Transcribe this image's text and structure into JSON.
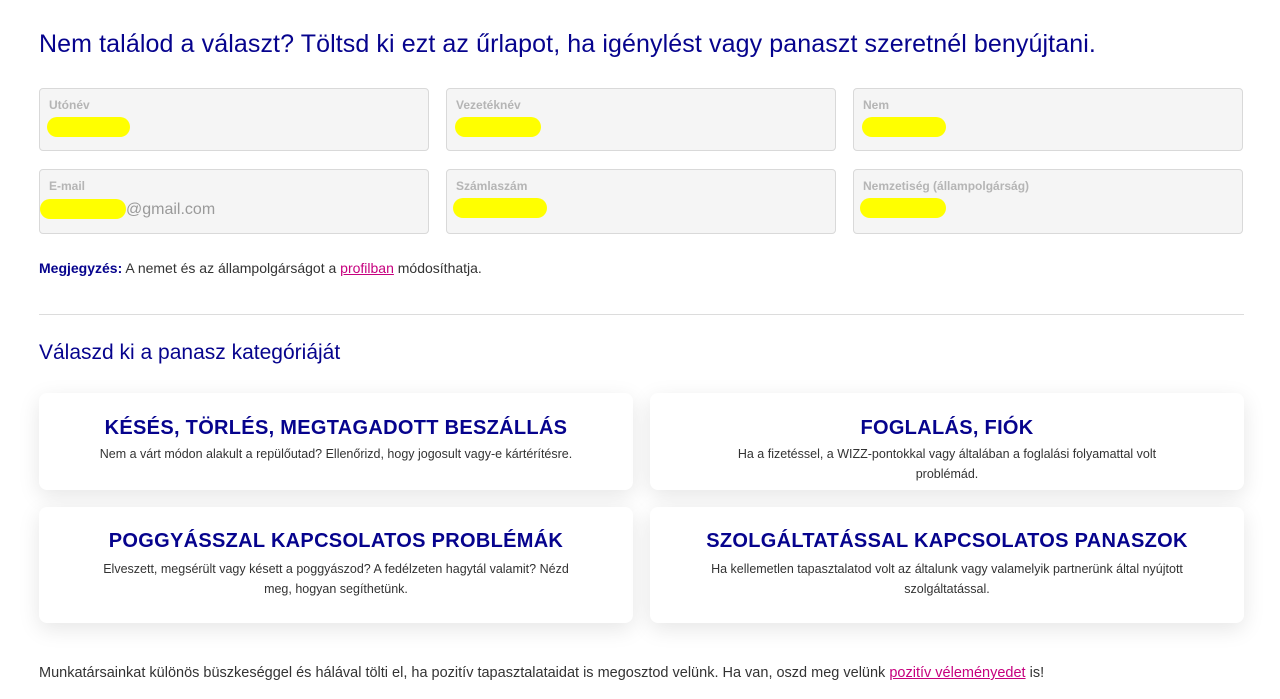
{
  "heading": "Nem találod a választ? Töltsd ki ezt az űrlapot, ha igénylést vagy panaszt szeretnél benyújtani.",
  "fields": {
    "first_name": "Utónév",
    "last_name": "Vezetéknév",
    "gender": "Nem",
    "email": "E-mail",
    "email_suffix": "@gmail.com",
    "account_number": "Számlaszám",
    "nationality": "Nemzetiség (állampolgárság)"
  },
  "note": {
    "bold": "Megjegyzés:",
    "before": " A nemet és az állampolgárságot a ",
    "link": "profilban",
    "after": " módosíthatja."
  },
  "category_heading": "Válaszd ki a panasz kategóriáját",
  "categories": [
    {
      "title": "KÉSÉS, TÖRLÉS, MEGTAGADOTT BESZÁLLÁS",
      "desc": "Nem a várt módon alakult a repülőutad? Ellenőrizd, hogy jogosult vagy-e kártérítésre."
    },
    {
      "title": "FOGLALÁS, FIÓK",
      "desc": "Ha a fizetéssel, a WIZZ-pontokkal vagy általában a foglalási folyamattal volt problémád."
    },
    {
      "title": "POGGYÁSSZAL KAPCSOLATOS PROBLÉMÁK",
      "desc": "Elveszett, megsérült vagy késett a poggyászod? A fedélzeten hagytál valamit? Nézd meg, hogyan segíthetünk."
    },
    {
      "title": "SZOLGÁLTATÁSSAL KAPCSOLATOS PANASZOK",
      "desc": "Ha kellemetlen tapasztalatod volt az általunk vagy valamelyik partnerünk által nyújtott szolgáltatással."
    }
  ],
  "footer": {
    "before": "Munkatársainkat különös büszkeséggel és hálával tölti el, ha pozitív tapasztalataidat is megosztod velünk. Ha van, oszd meg velünk ",
    "link": "pozitív véleményedet",
    "after": " is!"
  },
  "colors": {
    "brand": "#06038d",
    "link": "#c6007e",
    "redaction": "#ffff00"
  }
}
